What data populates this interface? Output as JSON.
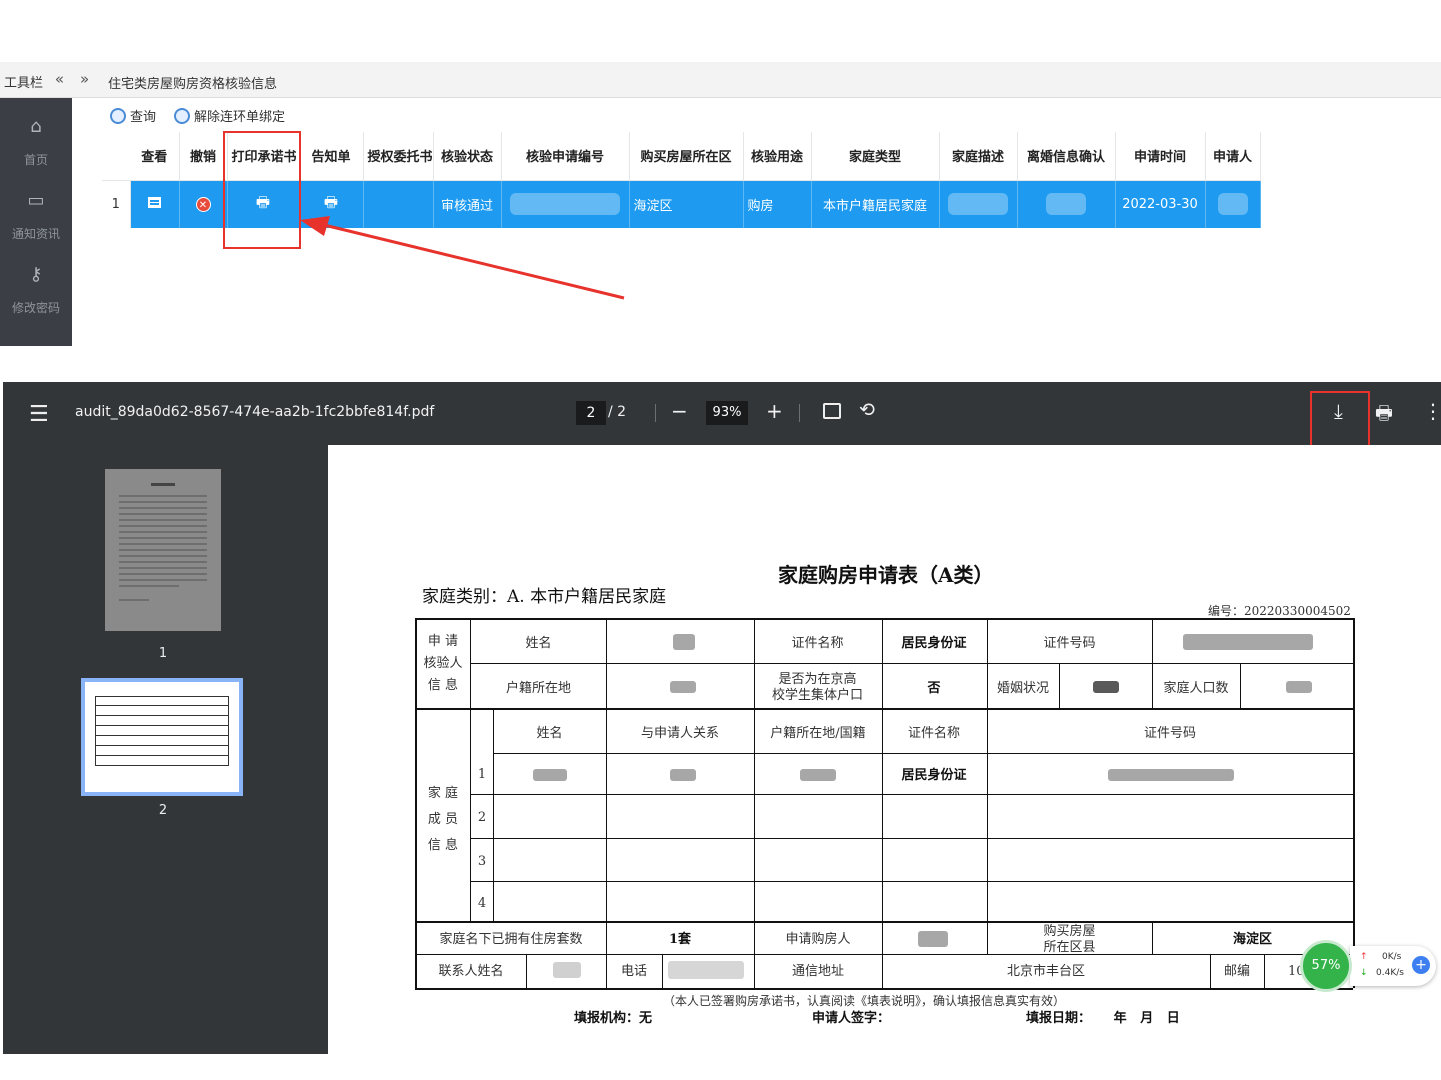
{
  "web": {
    "toolbar_label": "工具栏",
    "breadcrumb": "住宅类房屋购房资格核验信息",
    "sidebar": [
      {
        "label": "首页",
        "icon": "home-icon"
      },
      {
        "label": "通知资讯",
        "icon": "monitor-icon"
      },
      {
        "label": "修改密码",
        "icon": "key-icon"
      }
    ],
    "buttons": {
      "query": "查询",
      "unbind": "解除连环单绑定"
    },
    "columns": [
      "查看",
      "撤销",
      "打印承诺书",
      "告知单",
      "授权委托书",
      "核验状态",
      "核验申请编号",
      "购买房屋所在区",
      "核验用途",
      "家庭类型",
      "家庭描述",
      "离婚信息确认",
      "申请时间",
      "申请人"
    ],
    "row": {
      "index": "1",
      "status": "审核通过",
      "district": "海淀区",
      "purpose": "购房",
      "family_type": "本市户籍居民家庭",
      "apply_time": "2022-03-30"
    }
  },
  "pdf": {
    "filename": "audit_89da0d62-8567-474e-aa2b-1fc2bbfe814f.pdf",
    "page_current": "2",
    "page_total": "/ 2",
    "zoom": "93%",
    "thumbs": [
      "1",
      "2"
    ]
  },
  "form": {
    "title": "家庭购房申请表（A类）",
    "category": "家庭类别：A. 本市户籍居民家庭",
    "serial": "编号：20220330004502",
    "applicant_section": "申 请\n核验人\n信 息",
    "name": "姓名",
    "id_type": "证件名称",
    "id_type_value": "居民身份证",
    "id_no": "证件号码",
    "hukou": "户籍所在地",
    "collective": "是否为在京高\n校学生集体户口",
    "collective_value": "否",
    "marital": "婚姻状况",
    "family_count": "家庭人口数",
    "member_section": "家 庭\n成 员\n信 息",
    "relation": "与申请人关系",
    "hukou_nation": "户籍所在地/国籍",
    "member_rows": [
      "1",
      "2",
      "3",
      "4"
    ],
    "member1_id_type": "居民身份证",
    "owned_label": "家庭名下已拥有住房套数",
    "owned_value": "1套",
    "buyer_label": "申请购房人",
    "district_label": "购买房屋\n所在区县",
    "district_value": "海淀区",
    "contact_label": "联系人姓名",
    "phone_label": "电话",
    "address_label": "通信地址",
    "address_value": "北京市丰台区",
    "postcode_label": "邮编",
    "postcode_value": "10",
    "declaration": "（本人已签署购房承诺书，认真阅读《填表说明》，确认填报信息真实有效）",
    "org": "填报机构：无",
    "signature": "申请人签字：",
    "date": "填报日期：     年   月   日"
  },
  "speed": {
    "percent": "57%",
    "up": "0K/s",
    "down": "0.4K/s"
  },
  "colors": {
    "selected_row": "#1e9bf0",
    "highlight_box": "#e8322c",
    "viewer_toolbar": "#323639"
  }
}
